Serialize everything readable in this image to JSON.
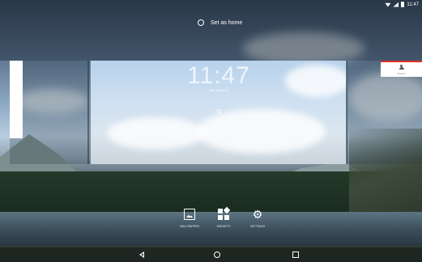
{
  "status_bar": {
    "time": "11:47"
  },
  "set_home": {
    "label": "Set as home"
  },
  "preview": {
    "clock": "11:47",
    "date": "Thu, August 25"
  },
  "widget_card": {
    "label": "Account"
  },
  "options": [
    {
      "label": "WALLPAPERS",
      "icon": "wallpaper-icon"
    },
    {
      "label": "WIDGETS",
      "icon": "widgets-icon"
    },
    {
      "label": "SETTINGS",
      "icon": "gear-icon"
    }
  ],
  "nav": {
    "back": "back-icon",
    "home": "home-icon",
    "recents": "recents-icon"
  },
  "colors": {
    "card_accent": "#e03030"
  }
}
